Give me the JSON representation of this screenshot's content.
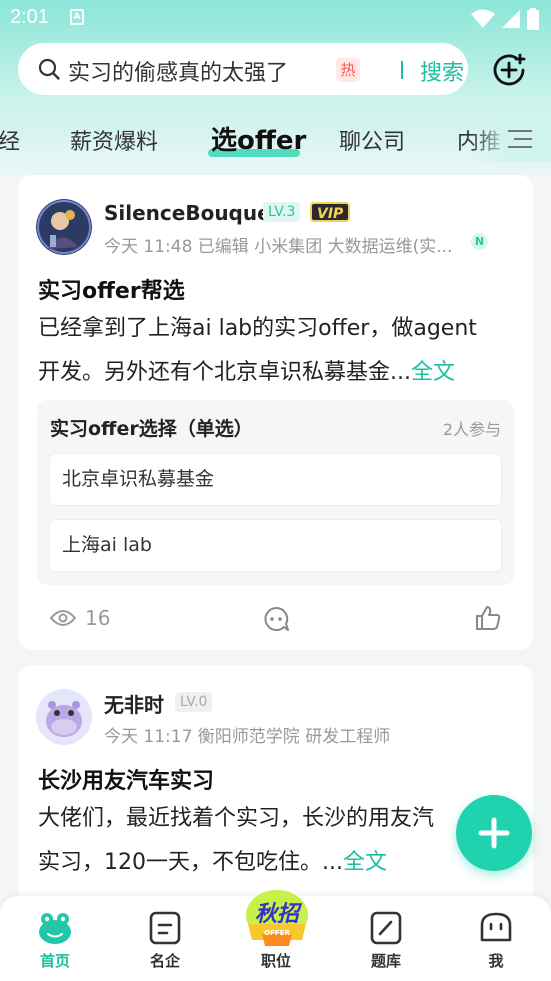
{
  "status_bar": {
    "time": "2:01",
    "notification_glyph": "A"
  },
  "search": {
    "query": "实习的偷感真的太强了",
    "hot_badge": "热",
    "button_label": "搜索"
  },
  "tabs": [
    "经",
    "薪资爆料",
    "选offer",
    "聊公司",
    "内推"
  ],
  "active_tab": "选offer",
  "posts": [
    {
      "username": "SilenceBouquet",
      "level": "LV.3",
      "vip": "VIP",
      "meta": "今天 11:48 已编辑 小米集团 大数据运维(实...",
      "meta_badge": "N",
      "title": "实习offer帮选",
      "body_line1": "已经拿到了上海ai lab的实习offer，做agent",
      "body_line2": "开发。另外还有个北京卓识私募基金...",
      "fulltext_label": "全文",
      "poll": {
        "title": "实习offer选择（单选）",
        "participants": "2人参与",
        "options": [
          "北京卓识私募基金",
          "上海ai lab"
        ]
      },
      "views": "16"
    },
    {
      "username": "无非时",
      "level": "LV.0",
      "meta": "今天 11:17 衡阳师范学院 研发工程师",
      "title": "长沙用友汽车实习",
      "body_line1": "大佬们，最近找着个实习，长沙的用友汽",
      "body_line2": "实习，120一天，不包吃住。...",
      "fulltext_label": "全文"
    }
  ],
  "bottom_nav": [
    {
      "label": "首页",
      "icon": "frog-home-icon",
      "active": true
    },
    {
      "label": "名企",
      "icon": "company-icon",
      "active": false
    },
    {
      "label": "职位",
      "icon": "autumn-recruit-promo-icon",
      "active": false
    },
    {
      "label": "题库",
      "icon": "question-bank-icon",
      "active": false
    },
    {
      "label": "我",
      "icon": "profile-face-icon",
      "active": false
    }
  ],
  "promo_badge": {
    "text": "秋招",
    "ribbon": "OFFER"
  },
  "colors": {
    "accent": "#1dbf9f",
    "fab": "#20d2ae",
    "hot": "#ff5a4c"
  }
}
